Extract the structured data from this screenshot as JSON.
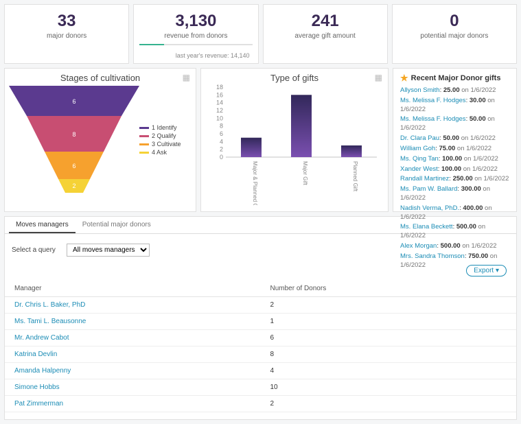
{
  "kpis": [
    {
      "value": "33",
      "label": "major donors"
    },
    {
      "value": "3,130",
      "label": "revenue from donors",
      "sub": "last year's revenue: 14,140"
    },
    {
      "value": "241",
      "label": "average gift amount"
    },
    {
      "value": "0",
      "label": "potential major donors"
    }
  ],
  "funnel": {
    "title": "Stages of cultivation",
    "legend": [
      {
        "color": "#5b3a8f",
        "label": "1 Identify"
      },
      {
        "color": "#c84e72",
        "label": "2 Qualify"
      },
      {
        "color": "#f6a12e",
        "label": "3 Cultivate"
      },
      {
        "color": "#f5d236",
        "label": "4 Ask"
      }
    ],
    "values": [
      "6",
      "8",
      "6",
      "2"
    ]
  },
  "bar": {
    "title": "Type of gifts",
    "yticks": [
      "0",
      "2",
      "4",
      "6",
      "8",
      "10",
      "12",
      "14",
      "16",
      "18"
    ],
    "categories": [
      "Major & Planned Gift",
      "Major Gift",
      "Planned Gift"
    ]
  },
  "chart_data": [
    {
      "type": "funnel",
      "title": "Stages of cultivation",
      "categories": [
        "1 Identify",
        "2 Qualify",
        "3 Cultivate",
        "4 Ask"
      ],
      "values": [
        6,
        8,
        6,
        2
      ],
      "colors": [
        "#5b3a8f",
        "#c84e72",
        "#f6a12e",
        "#f5d236"
      ]
    },
    {
      "type": "bar",
      "title": "Type of gifts",
      "categories": [
        "Major & Planned Gift",
        "Major Gift",
        "Planned Gift"
      ],
      "values": [
        5,
        16,
        3
      ],
      "ylim": [
        0,
        18
      ],
      "xlabel": "",
      "ylabel": ""
    }
  ],
  "gifts": {
    "title": "Recent Major Donor gifts",
    "items": [
      {
        "donor": "Allyson Smith",
        "amount": "25.00",
        "date": "1/6/2022"
      },
      {
        "donor": "Ms. Melissa F. Hodges",
        "amount": "30.00",
        "date": "1/6/2022"
      },
      {
        "donor": "Ms. Melissa F. Hodges",
        "amount": "50.00",
        "date": "1/6/2022"
      },
      {
        "donor": "Dr. Clara Pau",
        "amount": "50.00",
        "date": "1/6/2022"
      },
      {
        "donor": "William Goh",
        "amount": "75.00",
        "date": "1/6/2022"
      },
      {
        "donor": "Ms. Qing Tan",
        "amount": "100.00",
        "date": "1/6/2022"
      },
      {
        "donor": "Xander West",
        "amount": "100.00",
        "date": "1/6/2022"
      },
      {
        "donor": "Randall Martinez",
        "amount": "250.00",
        "date": "1/6/2022"
      },
      {
        "donor": "Ms. Pam W. Ballard",
        "amount": "300.00",
        "date": "1/6/2022"
      },
      {
        "donor": "Nadish Verma, PhD.",
        "amount": "400.00",
        "date": "1/6/2022"
      },
      {
        "donor": "Ms. Elana Beckett",
        "amount": "500.00",
        "date": "1/6/2022"
      },
      {
        "donor": "Alex Morgan",
        "amount": "500.00",
        "date": "1/6/2022"
      },
      {
        "donor": "Mrs. Sandra Thomson",
        "amount": "750.00",
        "date": "1/6/2022"
      }
    ],
    "on_word": "on"
  },
  "tabs": {
    "active": "Moves managers",
    "other": "Potential major donors"
  },
  "query": {
    "label": "Select a query",
    "selected": "All moves managers"
  },
  "export_label": "Export",
  "managers_table": {
    "col1": "Manager",
    "col2": "Number of Donors",
    "rows": [
      {
        "name": "Dr. Chris L. Baker, PhD",
        "count": "2"
      },
      {
        "name": "Ms. Tami L. Beausonne",
        "count": "1"
      },
      {
        "name": "Mr. Andrew Cabot",
        "count": "6"
      },
      {
        "name": "Katrina Devlin",
        "count": "8"
      },
      {
        "name": "Amanda Halpenny",
        "count": "4"
      },
      {
        "name": "Simone Hobbs",
        "count": "10"
      },
      {
        "name": "Pat Zimmerman",
        "count": "2"
      }
    ]
  }
}
